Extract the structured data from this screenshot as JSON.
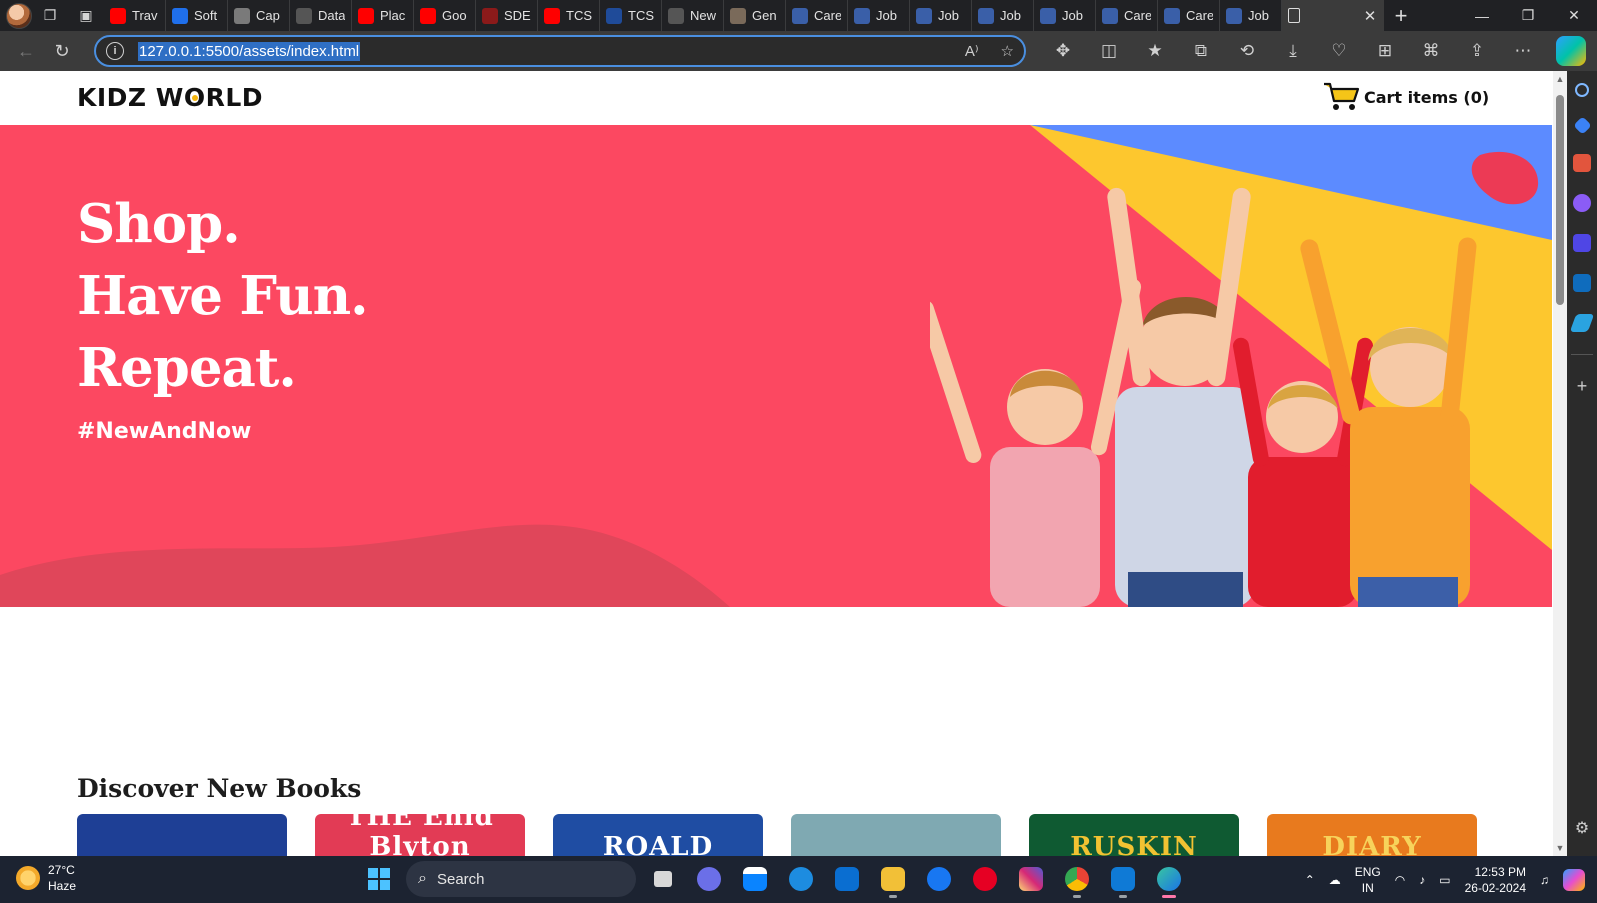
{
  "browser": {
    "tabs": [
      {
        "label": "Trav",
        "favicon": "youtube-icon",
        "color": "#ff0000"
      },
      {
        "label": "Soft",
        "favicon": "s-logo-icon",
        "color": "#1f6feb"
      },
      {
        "label": "Cap",
        "favicon": "wordpress-icon",
        "color": "#7a7a7a"
      },
      {
        "label": "Data",
        "favicon": "circle-logo-icon",
        "color": "#555555"
      },
      {
        "label": "Plac",
        "favicon": "youtube-icon",
        "color": "#ff0000"
      },
      {
        "label": "Goo",
        "favicon": "youtube-icon",
        "color": "#ff0000"
      },
      {
        "label": "SDE",
        "favicon": "tuf-icon",
        "color": "#8b1a1a"
      },
      {
        "label": "TCS",
        "favicon": "youtube-icon",
        "color": "#ff0000"
      },
      {
        "label": "TCS",
        "favicon": "power-icon",
        "color": "#1f4b99"
      },
      {
        "label": "New",
        "favicon": "newtab-icon",
        "color": "#555555"
      },
      {
        "label": "Gen",
        "favicon": "image-icon",
        "color": "#7a6a5a"
      },
      {
        "label": "Care",
        "favicon": "brand-c-icon",
        "color": "#3a5fa8"
      },
      {
        "label": "Job",
        "favicon": "brand-c-icon",
        "color": "#3a5fa8"
      },
      {
        "label": "Job",
        "favicon": "brand-c-icon",
        "color": "#3a5fa8"
      },
      {
        "label": "Job",
        "favicon": "brand-c-icon",
        "color": "#3a5fa8"
      },
      {
        "label": "Job",
        "favicon": "brand-c-icon",
        "color": "#3a5fa8"
      },
      {
        "label": "Care",
        "favicon": "brand-c-icon",
        "color": "#3a5fa8"
      },
      {
        "label": "Care",
        "favicon": "brand-c-icon",
        "color": "#3a5fa8"
      },
      {
        "label": "Job",
        "favicon": "brand-c-icon",
        "color": "#3a5fa8"
      }
    ],
    "active_tab_icon": "page-icon",
    "url": "127.0.0.1:5500/assets/index.html",
    "read_aloud_label": "A⁾"
  },
  "site": {
    "logo_part1": "KIDZ W",
    "logo_o": "O",
    "logo_part2": "RLD",
    "cart_label": "Cart items (0)",
    "hero": {
      "line1": "Shop.",
      "line2": "Have Fun.",
      "line3": "Repeat.",
      "tag": "#NewAndNow",
      "bg_color": "#fc4861"
    },
    "section_title": "Discover New Books",
    "books": [
      {
        "label": "",
        "bg": "#1e3f95",
        "fg": "#ffffff"
      },
      {
        "label": "THE  Enid Blyton",
        "bg": "#e23b55",
        "fg": "#ffffff"
      },
      {
        "label": "ROALD",
        "bg": "#1f4da3",
        "fg": "#ffffff"
      },
      {
        "label": "",
        "bg": "#7fa9b2",
        "fg": "#ffffff"
      },
      {
        "label": "RUSKIN",
        "bg": "#0f5a32",
        "fg": "#f2c232"
      },
      {
        "label": "DIARY",
        "bg": "#e87a1e",
        "fg": "#f7d35b"
      }
    ]
  },
  "taskbar": {
    "temperature": "27°C",
    "condition": "Haze",
    "search_label": "Search",
    "language": "ENG",
    "region": "IN",
    "time": "12:53 PM",
    "date": "26-02-2024"
  }
}
